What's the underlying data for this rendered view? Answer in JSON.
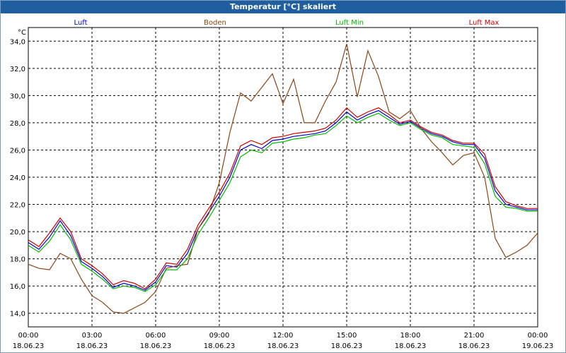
{
  "window": {
    "title": "Temperatur [°C] skaliert"
  },
  "chart_data": {
    "type": "line",
    "title": "Temperatur [°C] skaliert",
    "ylabel": "°C",
    "xlabel": "",
    "x_unit_hours": true,
    "xlim": [
      0,
      24
    ],
    "ylim": [
      13,
      35
    ],
    "grid": true,
    "legend_placement": "top",
    "yticks": [
      "14,0",
      "16,0",
      "18,0",
      "20,0",
      "22,0",
      "24,0",
      "26,0",
      "28,0",
      "30,0",
      "32,0",
      "34,0"
    ],
    "yticks_values": [
      14,
      16,
      18,
      20,
      22,
      24,
      26,
      28,
      30,
      32,
      34
    ],
    "xticks": [
      {
        "time": "00:00",
        "date": "18.06.23"
      },
      {
        "time": "03:00",
        "date": "18.06.23"
      },
      {
        "time": "06:00",
        "date": "18.06.23"
      },
      {
        "time": "09:00",
        "date": "18.06.23"
      },
      {
        "time": "12:00",
        "date": "18.06.23"
      },
      {
        "time": "15:00",
        "date": "18.06.23"
      },
      {
        "time": "18:00",
        "date": "18.06.23"
      },
      {
        "time": "21:00",
        "date": "18.06.23"
      },
      {
        "time": "00:00",
        "date": "19.06.23"
      }
    ],
    "xticks_hours": [
      0,
      3,
      6,
      9,
      12,
      15,
      18,
      21,
      24
    ],
    "series": [
      {
        "name": "Luft",
        "color": "#0000cc",
        "points": [
          [
            0,
            19.2
          ],
          [
            0.5,
            18.7
          ],
          [
            1,
            19.6
          ],
          [
            1.5,
            20.8
          ],
          [
            2,
            19.7
          ],
          [
            2.5,
            17.8
          ],
          [
            3,
            17.3
          ],
          [
            3.5,
            16.7
          ],
          [
            4,
            15.9
          ],
          [
            4.5,
            16.2
          ],
          [
            5,
            16.0
          ],
          [
            5.5,
            15.7
          ],
          [
            6,
            16.3
          ],
          [
            6.5,
            17.5
          ],
          [
            7,
            17.4
          ],
          [
            7.5,
            18.4
          ],
          [
            8,
            20.2
          ],
          [
            8.5,
            21.4
          ],
          [
            9,
            22.6
          ],
          [
            9.5,
            24.0
          ],
          [
            10,
            26.0
          ],
          [
            10.5,
            26.4
          ],
          [
            11,
            26.1
          ],
          [
            11.5,
            26.7
          ],
          [
            12,
            26.8
          ],
          [
            12.5,
            27.0
          ],
          [
            13,
            27.1
          ],
          [
            13.5,
            27.2
          ],
          [
            14,
            27.4
          ],
          [
            14.5,
            28.0
          ],
          [
            15,
            28.8
          ],
          [
            15.5,
            28.2
          ],
          [
            16,
            28.6
          ],
          [
            16.5,
            28.9
          ],
          [
            17,
            28.4
          ],
          [
            17.5,
            27.9
          ],
          [
            18,
            28.1
          ],
          [
            18.5,
            27.6
          ],
          [
            19,
            27.2
          ],
          [
            19.5,
            27.0
          ],
          [
            20,
            26.6
          ],
          [
            20.5,
            26.4
          ],
          [
            21,
            26.4
          ],
          [
            21.5,
            25.4
          ],
          [
            22,
            23.0
          ],
          [
            22.5,
            22.0
          ],
          [
            23,
            21.8
          ],
          [
            23.5,
            21.6
          ],
          [
            24,
            21.6
          ]
        ]
      },
      {
        "name": "Boden",
        "color": "#8b4513",
        "points": [
          [
            0,
            17.6
          ],
          [
            0.5,
            17.3
          ],
          [
            1,
            17.2
          ],
          [
            1.5,
            18.4
          ],
          [
            2,
            18.0
          ],
          [
            2.5,
            16.5
          ],
          [
            3,
            15.3
          ],
          [
            3.5,
            14.8
          ],
          [
            4,
            14.1
          ],
          [
            4.5,
            14.0
          ],
          [
            5,
            14.4
          ],
          [
            5.5,
            14.8
          ],
          [
            6,
            15.6
          ],
          [
            6.5,
            17.3
          ],
          [
            7,
            17.5
          ],
          [
            7.5,
            17.6
          ],
          [
            8,
            20.2
          ],
          [
            8.5,
            21.3
          ],
          [
            9,
            23.6
          ],
          [
            9.5,
            27.3
          ],
          [
            10,
            30.2
          ],
          [
            10.5,
            29.6
          ],
          [
            11,
            30.6
          ],
          [
            11.5,
            31.6
          ],
          [
            12,
            29.4
          ],
          [
            12.5,
            31.2
          ],
          [
            13,
            28.0
          ],
          [
            13.5,
            28.0
          ],
          [
            14,
            29.6
          ],
          [
            14.5,
            31.0
          ],
          [
            15,
            33.8
          ],
          [
            15.5,
            29.9
          ],
          [
            16,
            33.3
          ],
          [
            16.5,
            31.4
          ],
          [
            17,
            28.8
          ],
          [
            17.5,
            28.3
          ],
          [
            18,
            28.9
          ],
          [
            18.5,
            27.6
          ],
          [
            19,
            26.6
          ],
          [
            19.5,
            25.8
          ],
          [
            20,
            24.9
          ],
          [
            20.5,
            25.6
          ],
          [
            21,
            25.8
          ],
          [
            21.5,
            24.0
          ],
          [
            22,
            19.5
          ],
          [
            22.5,
            18.1
          ],
          [
            23,
            18.5
          ],
          [
            23.5,
            19.0
          ],
          [
            24,
            19.9
          ]
        ]
      },
      {
        "name": "Luft Min",
        "color": "#00bb00",
        "points": [
          [
            0,
            19.0
          ],
          [
            0.5,
            18.5
          ],
          [
            1,
            19.3
          ],
          [
            1.5,
            20.5
          ],
          [
            2,
            19.4
          ],
          [
            2.5,
            17.6
          ],
          [
            3,
            17.1
          ],
          [
            3.5,
            16.5
          ],
          [
            4,
            15.8
          ],
          [
            4.5,
            16.0
          ],
          [
            5,
            15.9
          ],
          [
            5.5,
            15.6
          ],
          [
            6,
            16.1
          ],
          [
            6.5,
            17.2
          ],
          [
            7,
            17.2
          ],
          [
            7.5,
            18.0
          ],
          [
            8,
            19.8
          ],
          [
            8.5,
            21.0
          ],
          [
            9,
            22.3
          ],
          [
            9.5,
            23.6
          ],
          [
            10,
            25.5
          ],
          [
            10.5,
            26.0
          ],
          [
            11,
            25.8
          ],
          [
            11.5,
            26.5
          ],
          [
            12,
            26.6
          ],
          [
            12.5,
            26.8
          ],
          [
            13,
            26.9
          ],
          [
            13.5,
            27.1
          ],
          [
            14,
            27.2
          ],
          [
            14.5,
            27.8
          ],
          [
            15,
            28.5
          ],
          [
            15.5,
            28.0
          ],
          [
            16,
            28.4
          ],
          [
            16.5,
            28.7
          ],
          [
            17,
            28.2
          ],
          [
            17.5,
            27.8
          ],
          [
            18,
            28.0
          ],
          [
            18.5,
            27.5
          ],
          [
            19,
            27.1
          ],
          [
            19.5,
            26.9
          ],
          [
            20,
            26.4
          ],
          [
            20.5,
            26.3
          ],
          [
            21,
            26.2
          ],
          [
            21.5,
            25.0
          ],
          [
            22,
            22.6
          ],
          [
            22.5,
            21.8
          ],
          [
            23,
            21.7
          ],
          [
            23.5,
            21.5
          ],
          [
            24,
            21.5
          ]
        ]
      },
      {
        "name": "Luft Max",
        "color": "#cc0000",
        "points": [
          [
            0,
            19.4
          ],
          [
            0.5,
            18.9
          ],
          [
            1,
            19.9
          ],
          [
            1.5,
            21.0
          ],
          [
            2,
            20.0
          ],
          [
            2.5,
            18.0
          ],
          [
            3,
            17.5
          ],
          [
            3.5,
            16.9
          ],
          [
            4,
            16.1
          ],
          [
            4.5,
            16.4
          ],
          [
            5,
            16.2
          ],
          [
            5.5,
            15.8
          ],
          [
            6,
            16.5
          ],
          [
            6.5,
            17.7
          ],
          [
            7,
            17.6
          ],
          [
            7.5,
            18.7
          ],
          [
            8,
            20.5
          ],
          [
            8.5,
            21.7
          ],
          [
            9,
            22.9
          ],
          [
            9.5,
            24.3
          ],
          [
            10,
            26.3
          ],
          [
            10.5,
            26.7
          ],
          [
            11,
            26.4
          ],
          [
            11.5,
            26.9
          ],
          [
            12,
            27.0
          ],
          [
            12.5,
            27.2
          ],
          [
            13,
            27.3
          ],
          [
            13.5,
            27.4
          ],
          [
            14,
            27.6
          ],
          [
            14.5,
            28.2
          ],
          [
            15,
            29.1
          ],
          [
            15.5,
            28.4
          ],
          [
            16,
            28.8
          ],
          [
            16.5,
            29.1
          ],
          [
            17,
            28.6
          ],
          [
            17.5,
            28.0
          ],
          [
            18,
            28.2
          ],
          [
            18.5,
            27.7
          ],
          [
            19,
            27.3
          ],
          [
            19.5,
            27.1
          ],
          [
            20,
            26.7
          ],
          [
            20.5,
            26.5
          ],
          [
            21,
            26.5
          ],
          [
            21.5,
            25.7
          ],
          [
            22,
            23.3
          ],
          [
            22.5,
            22.2
          ],
          [
            23,
            21.9
          ],
          [
            23.5,
            21.7
          ],
          [
            24,
            21.7
          ]
        ]
      }
    ]
  }
}
